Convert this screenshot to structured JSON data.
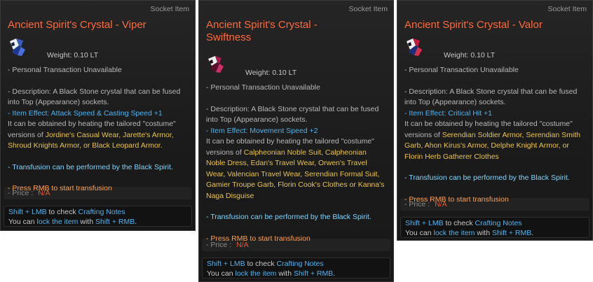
{
  "tooltips": [
    {
      "id": "viper",
      "kind": "Socket Item",
      "name": "Ancient Spirit's Crystal - Viper",
      "weight": "Weight:   0.10 LT",
      "lines": {
        "transaction": "- Personal Transaction Unavailable",
        "desc1": "- Description: A Black Stone crystal that can be fused",
        "desc2": "into Top (Appearance) sockets.",
        "effect": "- Item Effect: Attack Speed & Casting Speed +1",
        "obtain1": "It can be obtained by heating the tailored \"costume\"",
        "obtain2_prefix": "versions of ",
        "obtain_items": "Jordine's Casual Wear, Jarette's Armor, Shroud Knights Armor, or Black Leopard Armor.",
        "transfusion": "- Transfusion can be performed by the Black Spirit.",
        "press": "- Press RMB to start transfusion",
        "price_label": "- Price :",
        "price_value": "N/A"
      },
      "notes": {
        "shift_lmb": "Shift + LMB",
        "to_check": " to check ",
        "crafting": "Crafting Notes",
        "you_can": "You can ",
        "lock": "lock the item",
        "with": " with ",
        "shift_rmb": "Shift + RMB",
        "dot": "."
      }
    },
    {
      "id": "swiftness",
      "kind": "Socket Item",
      "name": "Ancient Spirit's Crystal - Swiftness",
      "weight": "Weight:   0.10 LT",
      "lines": {
        "transaction": "- Personal Transaction Unavailable",
        "desc1": "- Description: A Black Stone crystal that can be fused",
        "desc2": "into Top (Appearance) sockets.",
        "effect": "- Item Effect: Movement Speed +2",
        "obtain1": "It can be obtained by heating the tailored \"costume\"",
        "obtain2_prefix": "versions of ",
        "obtain_items": "Calpheonian Noble Suit, Calpheonian Noble Dress, Edan's Travel Wear, Orwen's Travel Wear, Valencian Travel Wear, Serendian Formal Suit, Gamier Troupe Garb, Florin Cook's Clothes or Kanna's Naga Disguise",
        "transfusion": "- Transfusion can be performed by the Black Spirit.",
        "press": "- Press RMB to start transfusion",
        "price_label": "- Price :",
        "price_value": "N/A"
      },
      "notes": {
        "shift_lmb": "Shift + LMB",
        "to_check": " to check ",
        "crafting": "Crafting Notes",
        "you_can": "You can ",
        "lock": "lock the item",
        "with": " with ",
        "shift_rmb": "Shift + RMB",
        "dot": "."
      }
    },
    {
      "id": "valor",
      "kind": "Socket Item",
      "name": "Ancient Spirit's Crystal - Valor",
      "weight": "Weight:   0.10 LT",
      "lines": {
        "transaction": "- Personal Transaction Unavailable",
        "desc1": "- Description: A Black Stone crystal that can be fused",
        "desc2": "into Top (Appearance) sockets.",
        "effect": "- Item Effect: Critical Hit +1",
        "obtain1": "It can be obtained by heating the tailored \"costume\"",
        "obtain2_prefix": "versions of ",
        "obtain_items": "Serendian Soldier Armor, Serendian Smith Garb, Ahon Kirus's Armor, Delphe Knight Armor, or Florin Herb Gatherer Clothes",
        "transfusion": "- Transfusion can be performed by the Black Spirit.",
        "press": "- Press RMB to start transfusion",
        "price_label": "- Price :",
        "price_value": "N/A"
      },
      "notes": {
        "shift_lmb": "Shift + LMB",
        "to_check": " to check ",
        "crafting": "Crafting Notes",
        "you_can": "You can ",
        "lock": "lock the item",
        "with": " with ",
        "shift_rmb": "Shift + RMB",
        "dot": "."
      }
    }
  ],
  "colors": {
    "title": "#ff6a3a",
    "effect": "#4db3f0",
    "highlight": "#e9c44a",
    "press": "#ff9b4a",
    "price_value": "#e05a3a"
  },
  "icons": [
    "crystal-viper-icon",
    "crystal-swiftness-icon",
    "crystal-valor-icon"
  ]
}
